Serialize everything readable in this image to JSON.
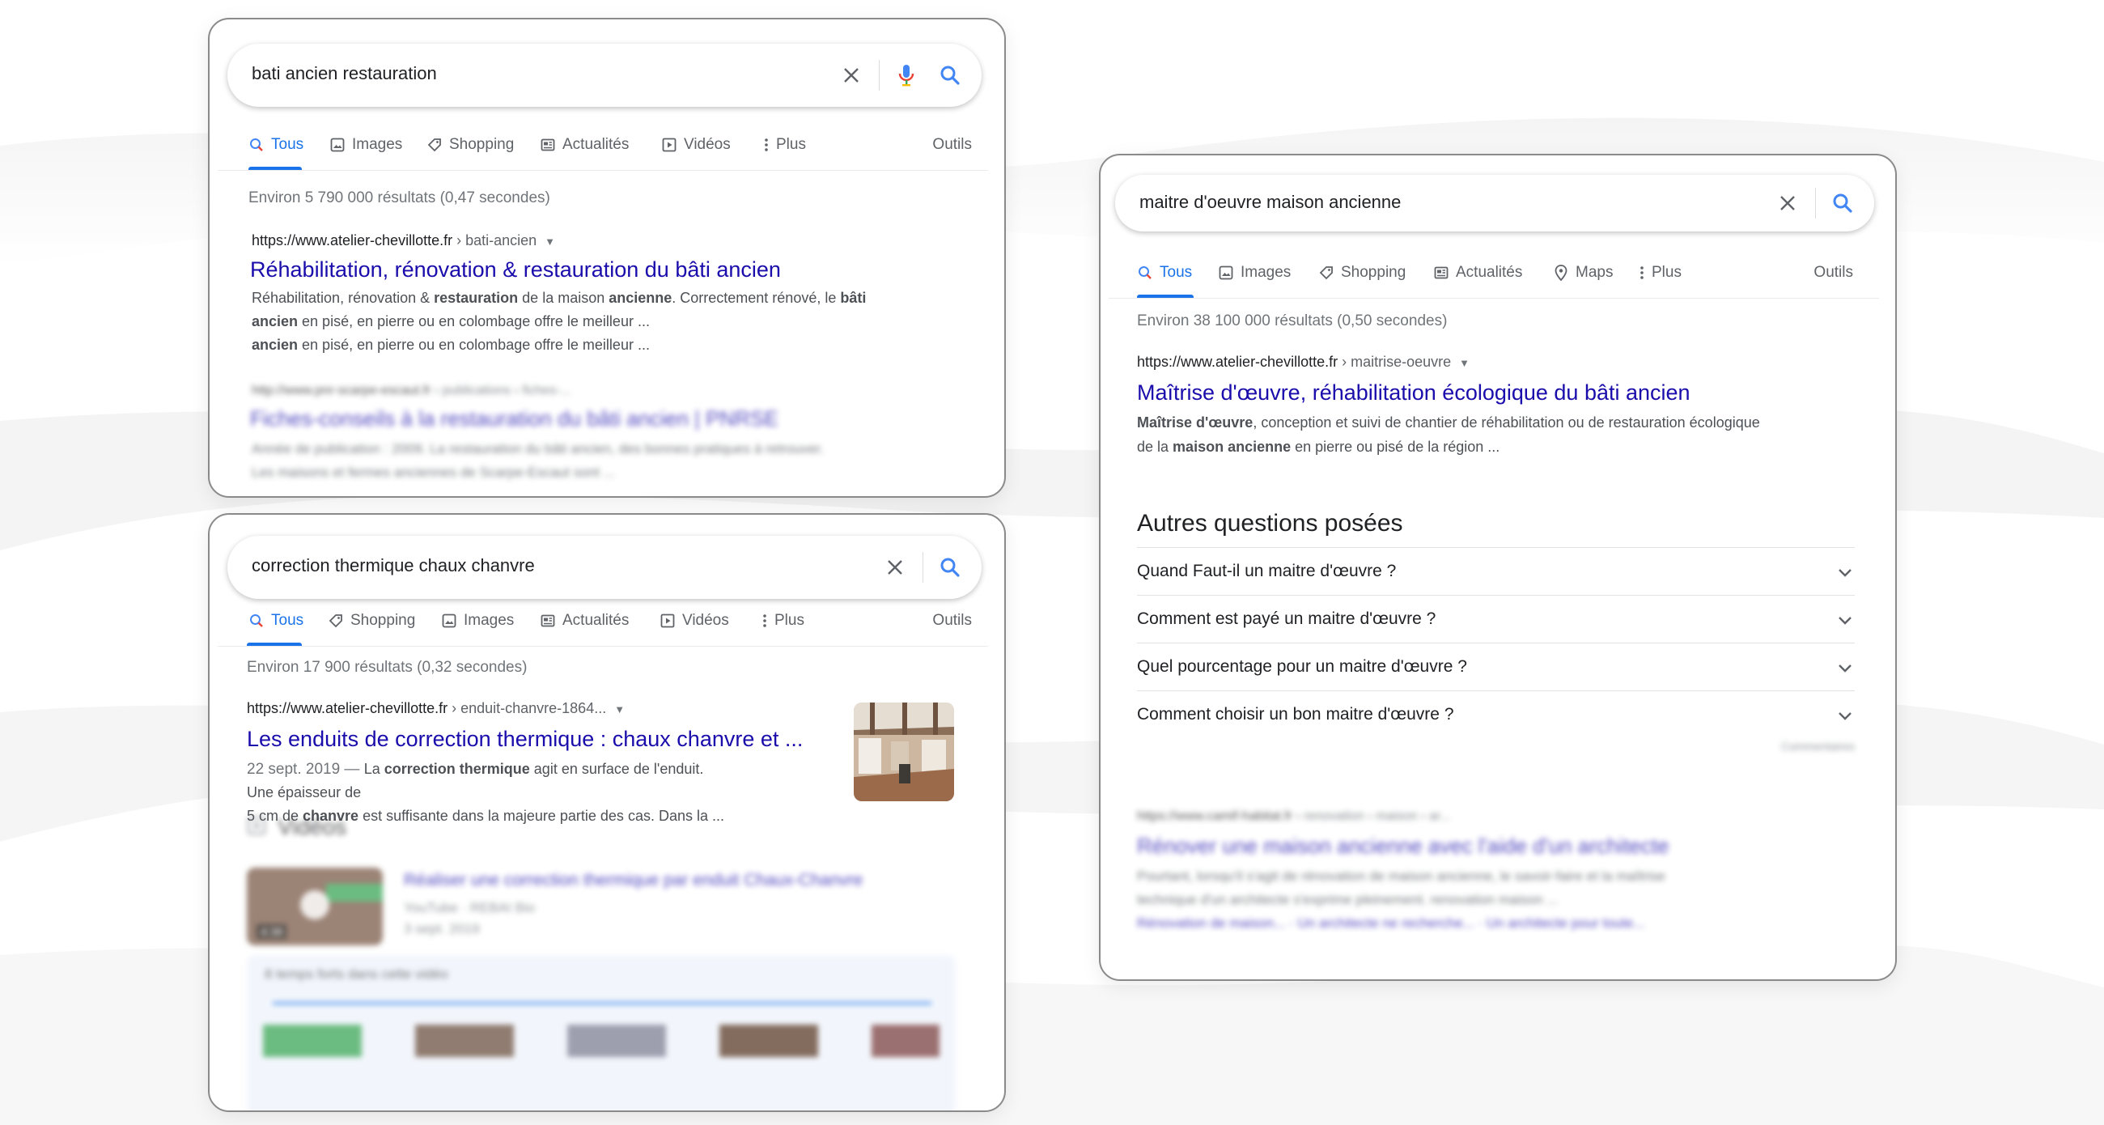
{
  "colors": {
    "accent": "#1a73e8",
    "link": "#1a0dab",
    "text": "#202124",
    "muted": "#70757a"
  },
  "panel1": {
    "query": "bati ancien restauration",
    "tabs": [
      {
        "label": "Tous",
        "icon": "search-icon"
      },
      {
        "label": "Images",
        "icon": "image-icon"
      },
      {
        "label": "Shopping",
        "icon": "tag-icon"
      },
      {
        "label": "Actualités",
        "icon": "news-icon"
      },
      {
        "label": "Vidéos",
        "icon": "video-icon"
      },
      {
        "label": "Plus",
        "icon": "more-vert-icon"
      }
    ],
    "tools": "Outils",
    "stats": "Environ 5 790 000 résultats (0,47 secondes)",
    "result1": {
      "url": "https://www.atelier-chevillotte.fr",
      "crumb": " › bati-ancien",
      "title": "Réhabilitation, rénovation & restauration du bâti ancien",
      "s1a": "Réhabilitation, rénovation & ",
      "s1b": "restauration",
      "s1c": " de la maison ",
      "s1d": "ancienne",
      "s1e": ". Correctement rénové, le ",
      "s1f": "bâti",
      "s2a": "ancien",
      "s2b": " en pisé, en pierre ou en colombage offre le meilleur ...",
      "s3a": "ancien",
      "s3b": " en pisé, en pierre ou en colombage offre le meilleur ..."
    },
    "result2": {
      "url": "http://www.pnr-scarpe-escaut.fr",
      "crumb": " › publications › fiches-...",
      "title": "Fiches-conseils à la restauration du bâti ancien | PNRSE",
      "s1": "Année de publication : 2009. La restauration du bâti ancien, des bonnes pratiques à retrouver.",
      "s2": "Les maisons et fermes anciennes de Scarpe-Escaut sont ..."
    }
  },
  "panel2": {
    "query": "correction thermique chaux chanvre",
    "tabs": [
      {
        "label": "Tous",
        "icon": "search-icon"
      },
      {
        "label": "Shopping",
        "icon": "tag-icon"
      },
      {
        "label": "Images",
        "icon": "image-icon"
      },
      {
        "label": "Actualités",
        "icon": "news-icon"
      },
      {
        "label": "Vidéos",
        "icon": "video-icon"
      },
      {
        "label": "Plus",
        "icon": "more-vert-icon"
      }
    ],
    "tools": "Outils",
    "stats": "Environ 17 900 résultats (0,32 secondes)",
    "result1": {
      "url": "https://www.atelier-chevillotte.fr",
      "crumb": " › enduit-chanvre-1864...",
      "title": "Les enduits de correction thermique : chaux chanvre et ...",
      "date": "22 sept. 2019 — ",
      "s1a": "La ",
      "s1b": "correction thermique",
      "s1c": " agit en surface de l'enduit. Une épaisseur de",
      "s2a": "5 cm de ",
      "s2b": "chanvre",
      "s2c": " est suffisante dans la majeure partie des cas. Dans la ..."
    },
    "videos": {
      "heading": "Vidéos",
      "title": "Réaliser une correction thermique par enduit Chaux-Chanvre",
      "source": "YouTube · REBAI Bio",
      "date": "3 sept. 2019",
      "duration": "4:38",
      "moments": "8 temps forts dans cette vidéo"
    }
  },
  "panel3": {
    "query": "maitre d'oeuvre maison ancienne",
    "tabs": [
      {
        "label": "Tous",
        "icon": "search-icon"
      },
      {
        "label": "Images",
        "icon": "image-icon"
      },
      {
        "label": "Shopping",
        "icon": "tag-icon"
      },
      {
        "label": "Actualités",
        "icon": "news-icon"
      },
      {
        "label": "Maps",
        "icon": "pin-icon"
      },
      {
        "label": "Plus",
        "icon": "more-vert-icon"
      }
    ],
    "tools": "Outils",
    "stats": "Environ 38 100 000 résultats (0,50 secondes)",
    "result1": {
      "url": "https://www.atelier-chevillotte.fr",
      "crumb": " › maitrise-oeuvre",
      "title": "Maîtrise d'œuvre, réhabilitation écologique du bâti ancien",
      "s1a": "Maîtrise d'œuvre",
      "s1b": ", conception et suivi de chantier de réhabilitation ou de restauration écologique",
      "s2a": "de la ",
      "s2b": "maison ancienne",
      "s2c": " en pierre ou pisé de la région ..."
    },
    "paa": {
      "heading": "Autres questions posées",
      "questions": [
        "Quand Faut-il un maitre d'œuvre ?",
        "Comment est payé un maitre d'œuvre ?",
        "Quel pourcentage pour un maitre d'œuvre ?",
        "Comment choisir un bon maitre d'œuvre ?"
      ],
      "feedback": "Commentaires"
    },
    "result2": {
      "url": "https://www.camif-habitat.fr",
      "crumb": " › renovation › maison › ar...",
      "title": "Rénover une maison ancienne avec l'aide d'un architecte",
      "s1": "Pourtant, lorsqu'il s'agit de rénovation de maison ancienne, le savoir-faire et la maîtrise",
      "s2": "technique d'un architecte s'exprime pleinement. renovation maison ...",
      "s3": "Rénovation de maison... · Un architecte ne recherche... · Un architecte pour toute..."
    }
  }
}
